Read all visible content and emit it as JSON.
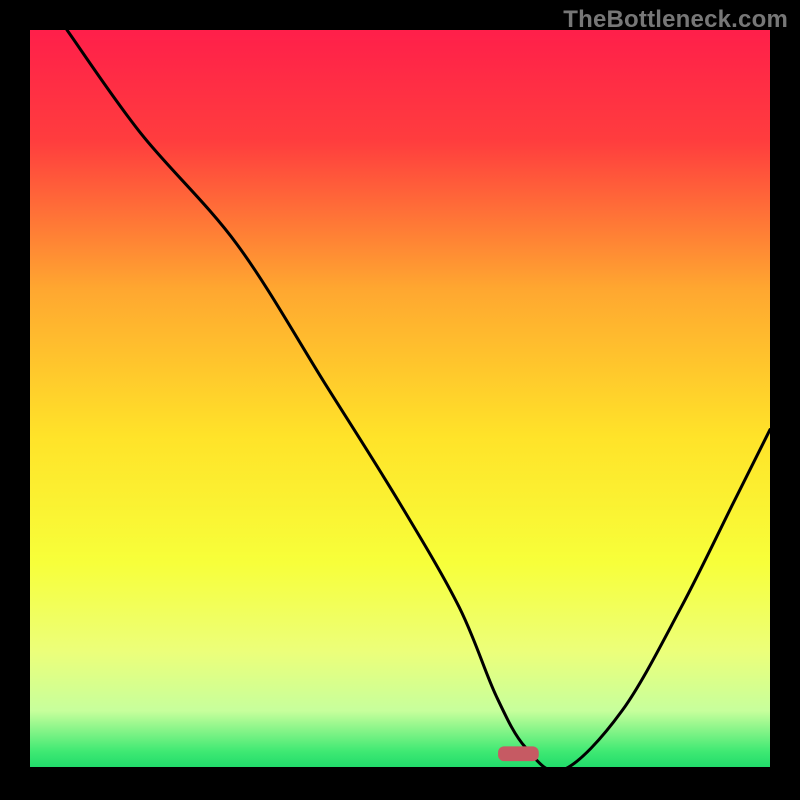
{
  "watermark": "TheBottleneck.com",
  "gradient": {
    "stops": [
      {
        "offset": 0.0,
        "color": "#ff1f4a"
      },
      {
        "offset": 0.15,
        "color": "#ff3d3e"
      },
      {
        "offset": 0.35,
        "color": "#ffa730"
      },
      {
        "offset": 0.55,
        "color": "#ffe329"
      },
      {
        "offset": 0.72,
        "color": "#f7ff3a"
      },
      {
        "offset": 0.84,
        "color": "#ecff7a"
      },
      {
        "offset": 0.92,
        "color": "#c7ff9c"
      },
      {
        "offset": 0.975,
        "color": "#3fe973"
      },
      {
        "offset": 1.0,
        "color": "#1bd969"
      }
    ]
  },
  "marker": {
    "x_pct": 0.66,
    "y_pct": 0.978,
    "w_pct": 0.055,
    "h_pct": 0.02,
    "color": "#c65a63"
  },
  "chart_data": {
    "type": "line",
    "title": "",
    "xlabel": "",
    "ylabel": "",
    "xlim": [
      0,
      100
    ],
    "ylim": [
      0,
      100
    ],
    "series": [
      {
        "name": "bottleneck-curve",
        "x": [
          5,
          15,
          28,
          40,
          50,
          58,
          63,
          67,
          72,
          80,
          88,
          95,
          100
        ],
        "y": [
          100,
          86,
          71,
          52,
          36,
          22,
          10,
          3,
          0,
          8,
          22,
          36,
          46
        ]
      }
    ],
    "optimal_x": 68
  }
}
